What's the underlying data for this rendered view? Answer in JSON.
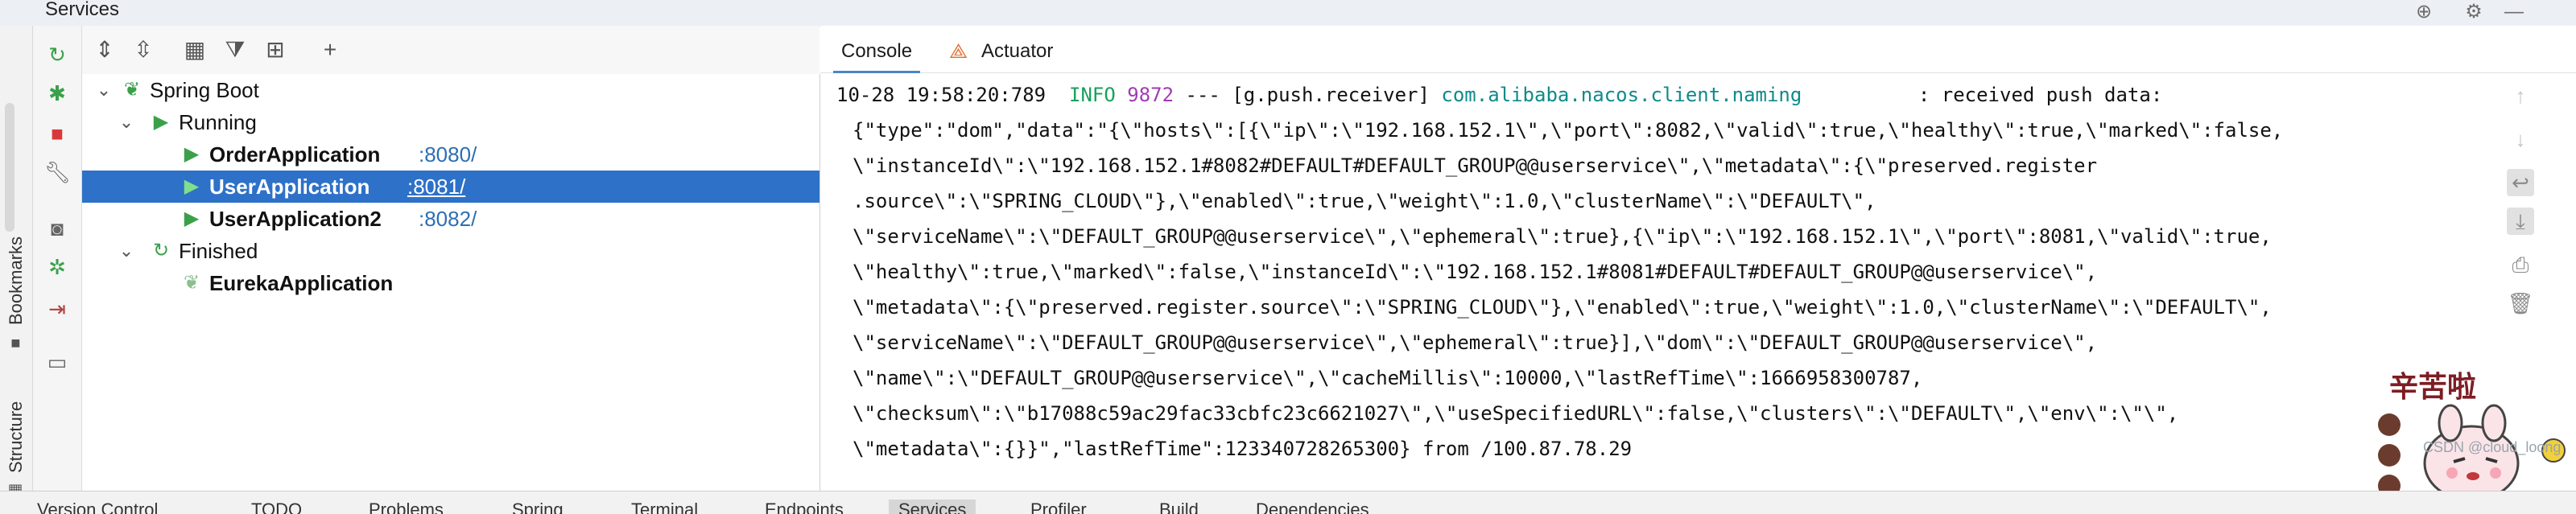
{
  "window": {
    "title": "Services"
  },
  "left_stripe": {
    "bookmarks_label": "Bookmarks",
    "structure_label": "Structure"
  },
  "tree": {
    "items": [
      {
        "label": "Spring Boot",
        "icon": "spring-boot-icon"
      },
      {
        "label": "Running",
        "icon": "run-icon"
      },
      {
        "label": "OrderApplication",
        "port": ":8080/",
        "icon": "run-icon"
      },
      {
        "label": "UserApplication",
        "port": ":8081/",
        "icon": "run-icon",
        "selected": true
      },
      {
        "label": "UserApplication2",
        "port": ":8082/",
        "icon": "run-icon"
      },
      {
        "label": "Finished",
        "icon": "rerun-icon"
      },
      {
        "label": "EurekaApplication",
        "icon": "spring-boot-icon"
      }
    ]
  },
  "tabs": [
    {
      "label": "Console",
      "active": true
    },
    {
      "label": "Actuator",
      "icon": "actuator-icon"
    }
  ],
  "console": {
    "first": {
      "timestamp": "10-28 19:58:20:789",
      "level": "INFO",
      "pid": "9872",
      "sep": "---",
      "thread": "[g.push.receiver]",
      "logger": "com.alibaba.nacos.client.naming",
      "message": ": received push data:"
    },
    "lines": [
      "{\"type\":\"dom\",\"data\":\"{\\\"hosts\\\":[{\\\"ip\\\":\\\"192.168.152.1\\\",\\\"port\\\":8082,\\\"valid\\\":true,\\\"healthy\\\":true,\\\"marked\\\":false,",
      "\\\"instanceId\\\":\\\"192.168.152.1#8082#DEFAULT#DEFAULT_GROUP@@userservice\\\",\\\"metadata\\\":{\\\"preserved.register",
      ".source\\\":\\\"SPRING_CLOUD\\\"},\\\"enabled\\\":true,\\\"weight\\\":1.0,\\\"clusterName\\\":\\\"DEFAULT\\\",",
      "\\\"serviceName\\\":\\\"DEFAULT_GROUP@@userservice\\\",\\\"ephemeral\\\":true},{\\\"ip\\\":\\\"192.168.152.1\\\",\\\"port\\\":8081,\\\"valid\\\":true,",
      "\\\"healthy\\\":true,\\\"marked\\\":false,\\\"instanceId\\\":\\\"192.168.152.1#8081#DEFAULT#DEFAULT_GROUP@@userservice\\\",",
      "\\\"metadata\\\":{\\\"preserved.register.source\\\":\\\"SPRING_CLOUD\\\"},\\\"enabled\\\":true,\\\"weight\\\":1.0,\\\"clusterName\\\":\\\"DEFAULT\\\",",
      "\\\"serviceName\\\":\\\"DEFAULT_GROUP@@userservice\\\",\\\"ephemeral\\\":true}],\\\"dom\\\":\\\"DEFAULT_GROUP@@userservice\\\",",
      "\\\"name\\\":\\\"DEFAULT_GROUP@@userservice\\\",\\\"cacheMillis\\\":10000,\\\"lastRefTime\\\":1666958300787,",
      "\\\"checksum\\\":\\\"b17088c59ac29fac33cbfc23c6621027\\\",\\\"useSpecifiedURL\\\":false,\\\"clusters\\\":\\\"DEFAULT\\\",\\\"env\\\":\\\"\\\",",
      "\\\"metadata\\\":{}}\",\"lastRefTime\":123340728265300} from /100.87.78.29"
    ]
  },
  "bottom_tabs": [
    "Version Control",
    "TODO",
    "Problems",
    "Spring",
    "Terminal",
    "Endpoints",
    "Services",
    "Profiler",
    "Build",
    "Dependencies"
  ],
  "bottom_active": "Services",
  "watermark": "CSDN @cloud_loong",
  "sticker_text": "辛苦啦",
  "colors": {
    "selection": "#2e71c8",
    "port_link": "#2c6fb3",
    "run_green": "#3aa14a",
    "info_green": "#17a05d",
    "pid_purple": "#a03cb4",
    "logger_teal": "#0f8a8a"
  }
}
